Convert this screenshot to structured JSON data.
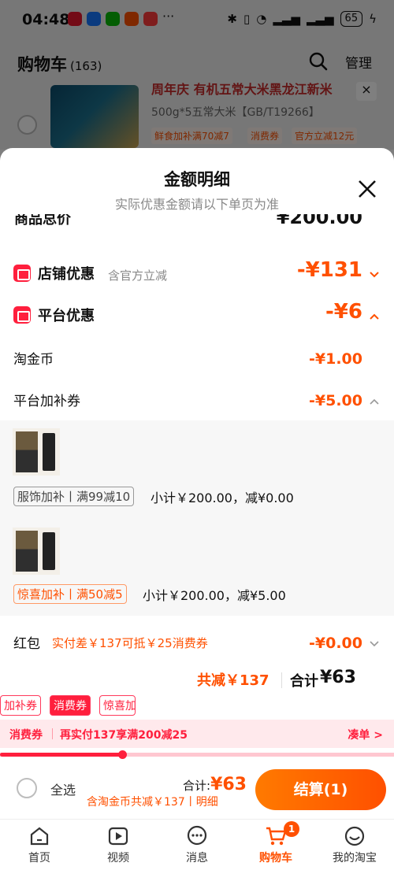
{
  "status_bar": {
    "time": "04:48",
    "dots": "···",
    "battery": "65"
  },
  "header": {
    "title": "购物车",
    "count": "(163)",
    "manage": "管理"
  },
  "product": {
    "title": "周年庆 有机五常大米黑龙江新米",
    "spec": "500g*5五常大米【GB/T19266】",
    "tags": [
      "鲜食加补满70减7",
      "消费券",
      "官方立减12元"
    ],
    "close": "×"
  },
  "sheet": {
    "title": "金额明细",
    "subtitle": "实际优惠金额请以下单页为准",
    "goods_label": "商品总价",
    "goods_value": "¥200.00",
    "shop_label": "店铺优惠",
    "shop_note": "含官方立减",
    "shop_value": "-¥131",
    "platform_label": "平台优惠",
    "platform_value": "-¥6",
    "coin_label": "淘金币",
    "coin_value": "-¥1.00",
    "subsidy_label": "平台加补券",
    "subsidy_value": "-¥5.00",
    "items": [
      {
        "voucher": "服饰加补丨满99减10",
        "subtotal": "小计￥200.00，减¥0.00"
      },
      {
        "voucher": "惊喜加补丨满50减5",
        "subtotal": "小计￥200.00，减¥5.00"
      }
    ],
    "redpack_label": "红包",
    "redpack_note": "实付差￥137可抵￥25消费券",
    "redpack_value": "-¥0.00",
    "total_reduce": "共减￥137",
    "total_sum_label": "合计",
    "total_sum": "¥63"
  },
  "pills": [
    "加补券",
    "消费券",
    "惊喜加"
  ],
  "promo": {
    "left": "消费券",
    "text": "再实付137享满200减25",
    "action": "凑单 >",
    "progress": 0.31
  },
  "bottom": {
    "select_all": "全选",
    "total_label": "合计:",
    "total_value": "¥63",
    "note": "含淘金币共减￥137丨明细",
    "checkout": "结算(1)"
  },
  "tabs": [
    {
      "label": "首页",
      "icon": "home-icon"
    },
    {
      "label": "视频",
      "icon": "video-icon"
    },
    {
      "label": "消息",
      "icon": "message-icon"
    },
    {
      "label": "购物车",
      "icon": "cart-icon",
      "badge": "1"
    },
    {
      "label": "我的淘宝",
      "icon": "profile-icon"
    }
  ],
  "colors": {
    "accent": "#ff5000",
    "red": "#ff1f3d"
  }
}
